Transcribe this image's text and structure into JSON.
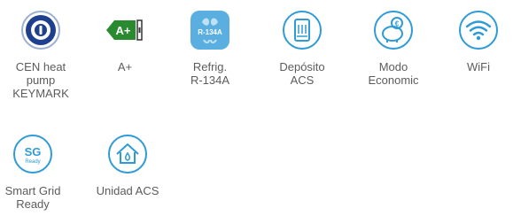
{
  "features": [
    {
      "label": "CEN heat\npump\nKEYMARK",
      "icon": "keymark-icon"
    },
    {
      "label": "A+",
      "icon": "energy-class-icon",
      "badge": "A+"
    },
    {
      "label": "Refrig.\nR-134A",
      "icon": "refrigerant-icon",
      "badge": "R-134A"
    },
    {
      "label": "Depósito\nACS",
      "icon": "tank-icon"
    },
    {
      "label": "Modo\nEconomic",
      "icon": "piggy-bank-icon"
    },
    {
      "label": "WiFi",
      "icon": "wifi-icon"
    },
    {
      "label": "Smart Grid\nReady",
      "icon": "smart-grid-icon",
      "badge": "SG",
      "badge_sub": "Ready"
    },
    {
      "label": "Unidad ACS",
      "icon": "house-tap-icon"
    }
  ],
  "colors": {
    "accent_blue": "#2f9bd6",
    "navy": "#1f3f8f",
    "green": "#2a8a2f",
    "text": "#5c5c5c"
  }
}
